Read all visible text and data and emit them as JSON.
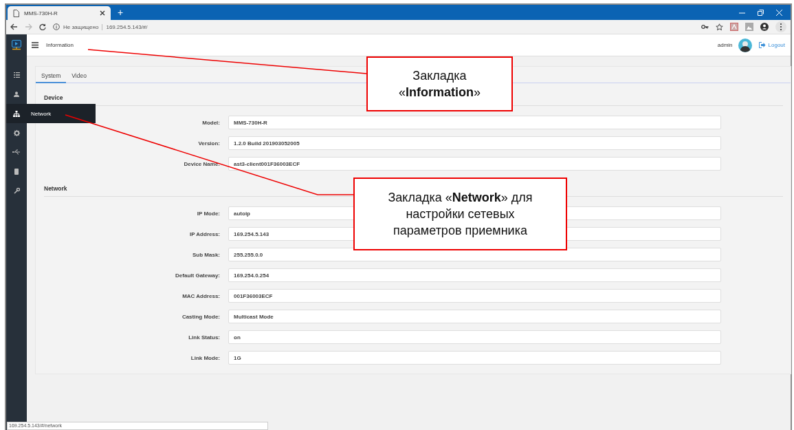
{
  "browser": {
    "tab_title": "MMS-730H-R",
    "new_tab": "+",
    "security": "Не защищено",
    "url": "169.254.5.143/#/"
  },
  "header": {
    "title": "Information",
    "user": "admin",
    "logout": "Logout"
  },
  "sidebar": {
    "items": [
      {
        "kind": "list",
        "selected": false
      },
      {
        "kind": "user",
        "selected": false
      },
      {
        "kind": "network",
        "selected": true,
        "tooltip": "Network"
      },
      {
        "kind": "gear",
        "selected": false
      },
      {
        "kind": "usb",
        "selected": false
      },
      {
        "kind": "storage",
        "selected": false
      },
      {
        "kind": "wrench",
        "selected": false
      }
    ]
  },
  "tabs": [
    {
      "label": "System",
      "selected": true
    },
    {
      "label": "Video",
      "selected": false
    }
  ],
  "sections": [
    {
      "title": "Device",
      "fields": [
        {
          "label": "Model:",
          "value": "MMS-730H-R"
        },
        {
          "label": "Version:",
          "value": "1.2.0 Build 201903052005"
        },
        {
          "label": "Device Name:",
          "value": "ast3-client001F36003ECF"
        }
      ]
    },
    {
      "title": "Network",
      "fields": [
        {
          "label": "IP Mode:",
          "value": "autoip"
        },
        {
          "label": "IP Address:",
          "value": "169.254.5.143"
        },
        {
          "label": "Sub Mask:",
          "value": "255.255.0.0"
        },
        {
          "label": "Default Gateway:",
          "value": "169.254.0.254"
        },
        {
          "label": "MAC Address:",
          "value": "001F36003ECF"
        },
        {
          "label": "Casting Mode:",
          "value": "Multicast Mode"
        },
        {
          "label": "Link Status:",
          "value": "on"
        },
        {
          "label": "Link Mode:",
          "value": "1G"
        }
      ]
    }
  ],
  "status_bar": "169.254.5.143/#/network",
  "annotations": [
    {
      "text": "Закладка «**Information**»"
    },
    {
      "text": "Закладка «**Network**» для настройки сетевых параметров приемника"
    }
  ]
}
